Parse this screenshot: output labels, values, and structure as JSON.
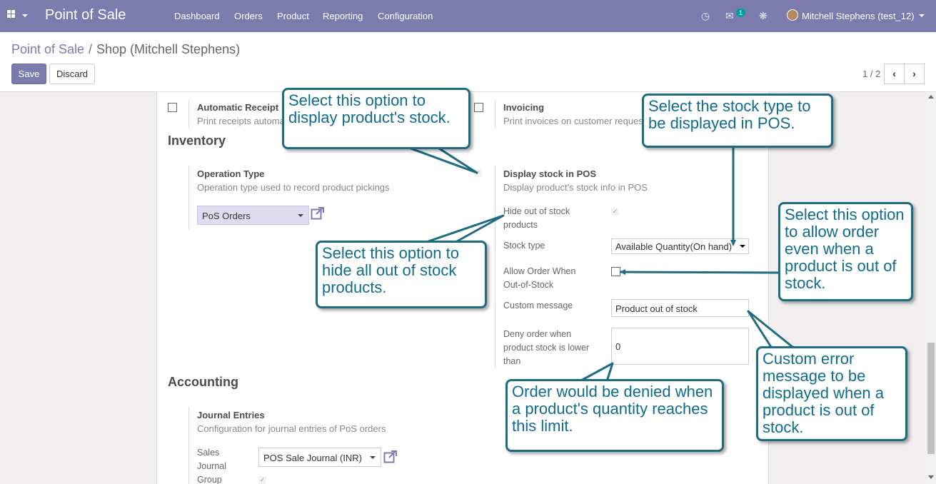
{
  "navbar": {
    "apps_icon": "grid-icon",
    "brand": "Point of Sale",
    "menu": [
      "Dashboard",
      "Orders",
      "Product",
      "Reporting",
      "Configuration"
    ],
    "icons": [
      "clock-icon",
      "chat-icon",
      "bug-icon"
    ],
    "chat_badge": "1",
    "user": "Mitchell Stephens (test_12)"
  },
  "breadcrumb": {
    "root": "Point of Sale",
    "separator": "/",
    "current": "Shop (Mitchell Stephens)"
  },
  "toolbar": {
    "save_label": "Save",
    "discard_label": "Discard",
    "pager": "1 / 2",
    "prev": "‹",
    "next": "›"
  },
  "settings_top": {
    "auto_receipt": {
      "title": "Automatic Receipt",
      "desc": "Print receipts automa"
    },
    "invoicing": {
      "title": "Invoicing",
      "desc": "Print invoices on customer reques"
    }
  },
  "inventory": {
    "title": "Inventory",
    "operation_type": {
      "title": "Operation Type",
      "desc": "Operation type used to record product pickings",
      "value": "PoS Orders"
    },
    "display_stock": {
      "title": "Display stock in POS",
      "desc": "Display product's stock info in POS",
      "hide_out_of_stock_label": "Hide out of stock products",
      "stock_type_label": "Stock type",
      "stock_type_value": "Available Quantity(On hand)",
      "allow_order_label": "Allow Order When Out-of-Stock",
      "custom_message_label": "Custom message",
      "custom_message_value": "Product out of stock",
      "deny_order_label": "Deny order when product stock is lower than",
      "deny_order_value": "0"
    }
  },
  "accounting": {
    "title": "Accounting",
    "journal_entries": {
      "title": "Journal Entries",
      "desc": "Configuration for journal entries of PoS orders",
      "sales_journal_label": "Sales Journal",
      "sales_journal_value": "POS Sale Journal (INR)",
      "group_label": "Group"
    }
  },
  "callouts": {
    "display_stock": "Select this option to display product's stock.",
    "stock_type": "Select the stock type to be displayed in POS.",
    "hide_out_of_stock": "Select this option to hide all out of stock products.",
    "allow_order": "Select this option to allow order even when a product is out of stock.",
    "custom_message": "Custom error message to be displayed when a product is out of stock.",
    "deny_order": "Order would be denied when a product's quantity reaches this limit."
  },
  "colors": {
    "navbar": "#7c7bad",
    "callout_border": "#1e6b82",
    "callout_text": "#0f6c8c"
  }
}
